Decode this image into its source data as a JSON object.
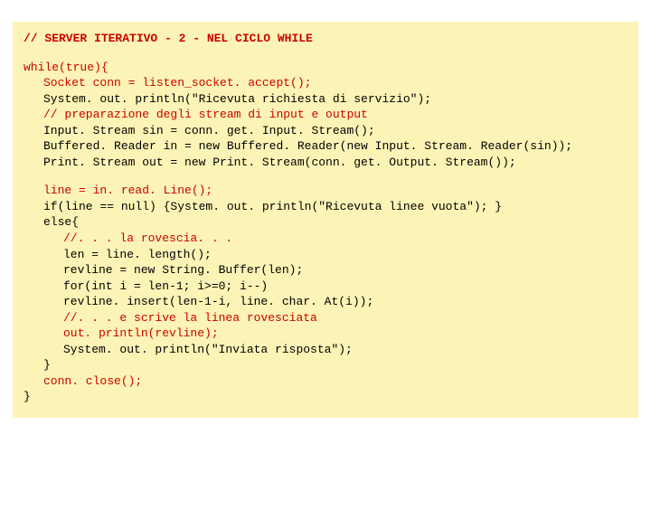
{
  "code": {
    "l01": "// SERVER ITERATIVO - 2 - NEL CICLO WHILE",
    "l02": "while(true){",
    "l03": "Socket conn = listen_socket. accept();",
    "l04": "System. out. println(\"Ricevuta richiesta di servizio\");",
    "l05": "// preparazione degli stream di input e output",
    "l06": "Input. Stream sin = conn. get. Input. Stream();",
    "l07": "Buffered. Reader in = new Buffered. Reader(new Input. Stream. Reader(sin));",
    "l08": "Print. Stream out = new Print. Stream(conn. get. Output. Stream());",
    "l09": "line = in. read. Line();",
    "l10": "if(line == null) {System. out. println(\"Ricevuta linee vuota\"); }",
    "l11": "else{",
    "l12": "//. . . la rovescia. . .",
    "l13": "len = line. length();",
    "l14": "revline = new String. Buffer(len);",
    "l15": "for(int i = len-1; i>=0; i--)",
    "l16": "revline. insert(len-1-i, line. char. At(i));",
    "l17": "//. . . e scrive la linea rovesciata",
    "l18": "out. println(revline);",
    "l19": "System. out. println(\"Inviata risposta\");",
    "l20": "}",
    "l21": "conn. close();",
    "l22": "}"
  }
}
